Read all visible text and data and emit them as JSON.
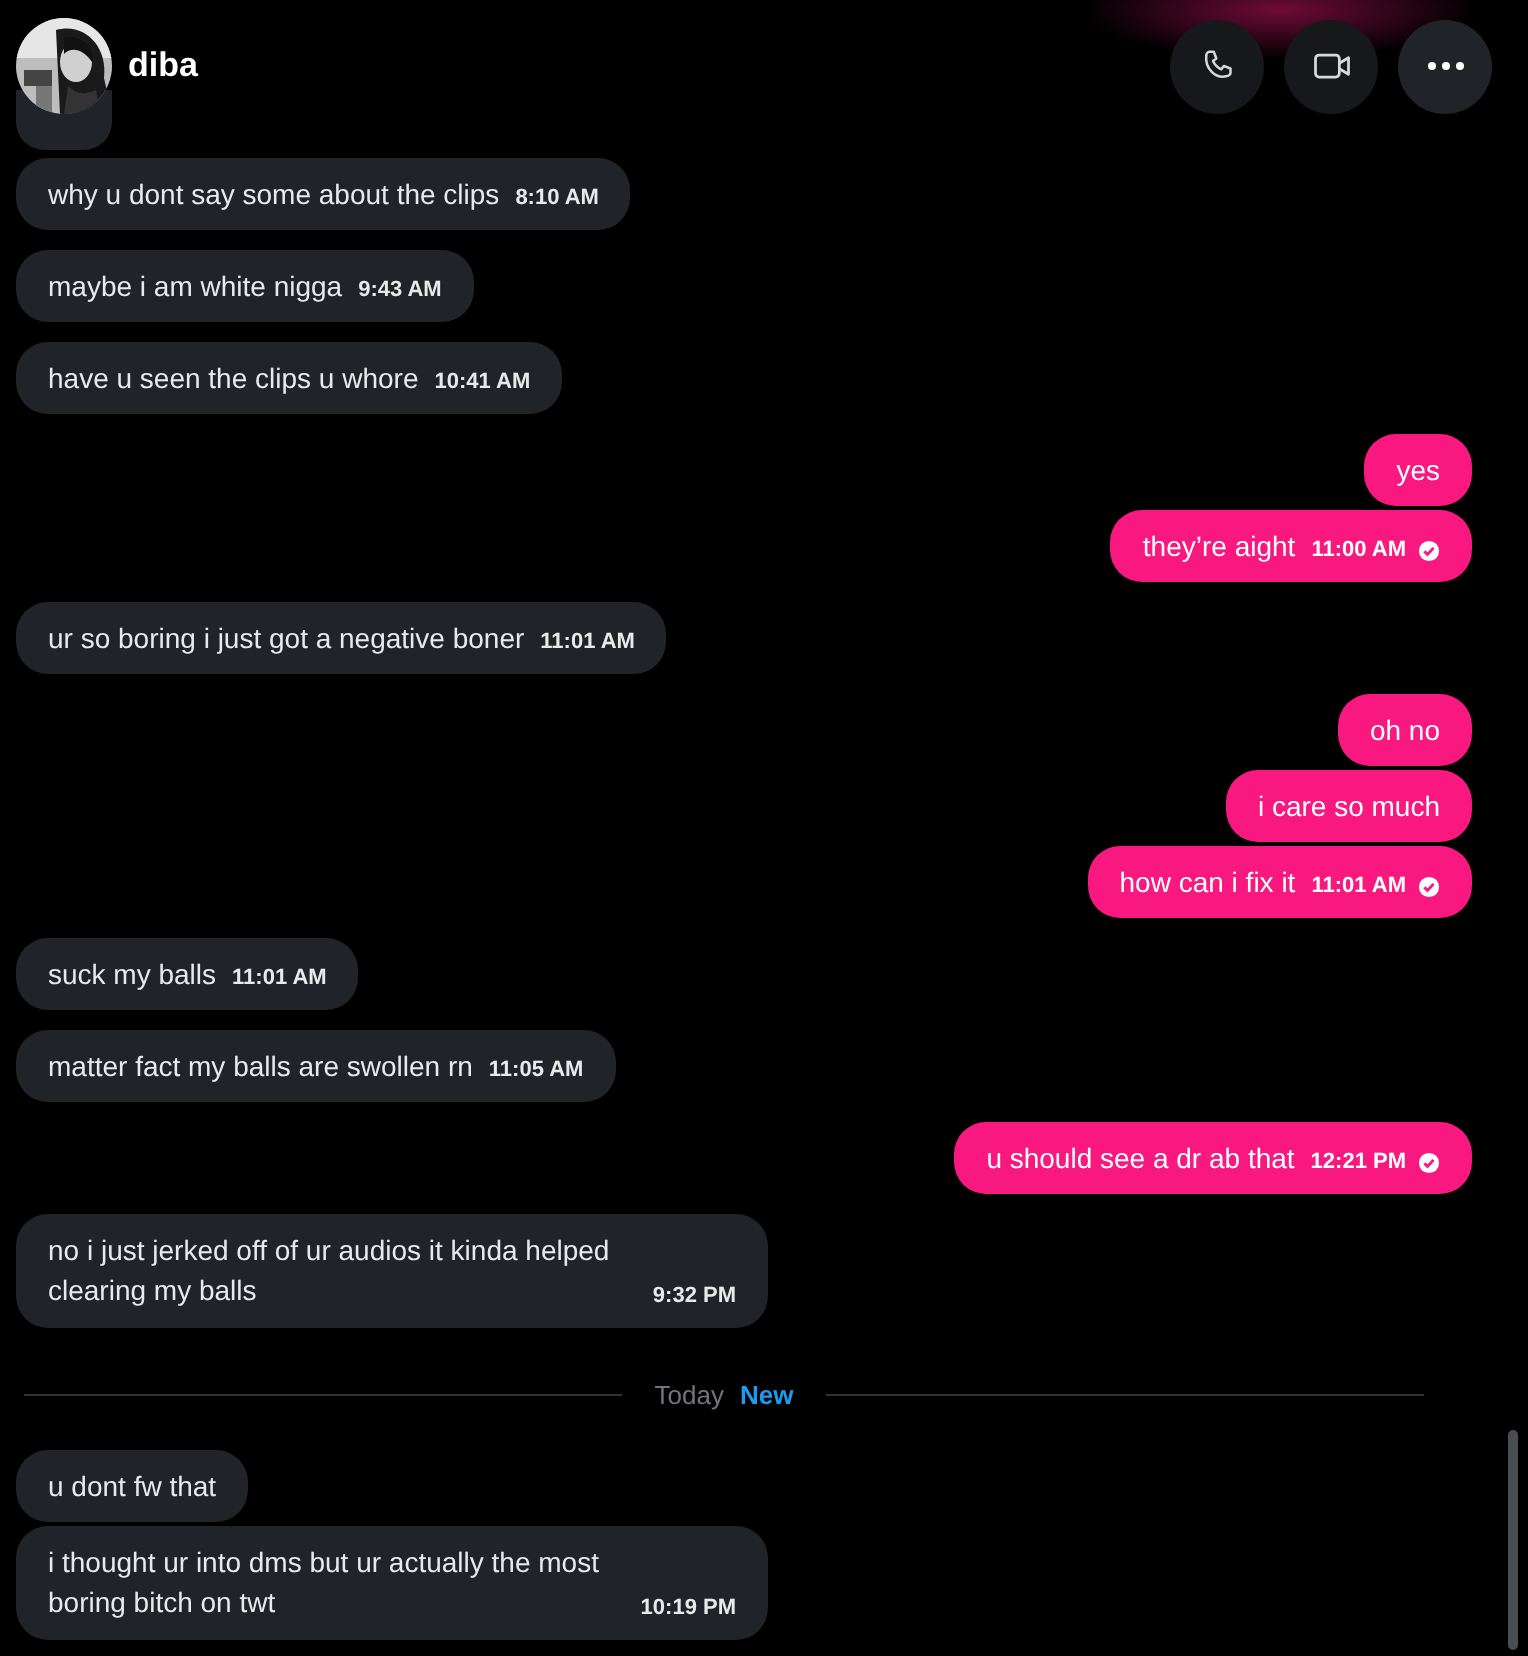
{
  "header": {
    "name": "diba",
    "buttons": [
      {
        "kind": "call"
      },
      {
        "kind": "video"
      },
      {
        "kind": "more"
      }
    ]
  },
  "messages": [
    {
      "kind": "message",
      "outgoing": false,
      "text": "why u dont say some about the clips",
      "time": "8:10 AM"
    },
    {
      "kind": "message",
      "outgoing": false,
      "text": "maybe i am white nigga",
      "time": "9:43 AM"
    },
    {
      "kind": "message",
      "outgoing": false,
      "text": "have u seen the clips u whore",
      "time": "10:41 AM"
    },
    {
      "kind": "message",
      "outgoing": true,
      "text": "yes"
    },
    {
      "kind": "message",
      "outgoing": true,
      "text": "they’re aight",
      "time": "11:00 AM",
      "read": true
    },
    {
      "kind": "message",
      "outgoing": false,
      "text": "ur so boring i just got a negative boner",
      "time": "11:01 AM"
    },
    {
      "kind": "message",
      "outgoing": true,
      "text": "oh no"
    },
    {
      "kind": "message",
      "outgoing": true,
      "text": "i care so much"
    },
    {
      "kind": "message",
      "outgoing": true,
      "text": "how can i fix it",
      "time": "11:01 AM",
      "read": true
    },
    {
      "kind": "message",
      "outgoing": false,
      "text": "suck my balls",
      "time": "11:01 AM"
    },
    {
      "kind": "message",
      "outgoing": false,
      "text": "matter fact my balls are swollen rn",
      "time": "11:05 AM"
    },
    {
      "kind": "message",
      "outgoing": true,
      "text": "u should see a dr ab that",
      "time": "12:21 PM",
      "read": true
    },
    {
      "kind": "message",
      "outgoing": false,
      "text": "no i just jerked off of ur audios it kinda helped clearing my balls",
      "time": "9:32 PM"
    },
    {
      "kind": "divider",
      "label": "Today",
      "badge": "New"
    },
    {
      "kind": "message",
      "outgoing": false,
      "text": "u dont fw that"
    },
    {
      "kind": "message",
      "outgoing": false,
      "text": "i thought ur into dms but ur actually the most boring bitch on twt",
      "time": "10:19 PM"
    }
  ]
}
